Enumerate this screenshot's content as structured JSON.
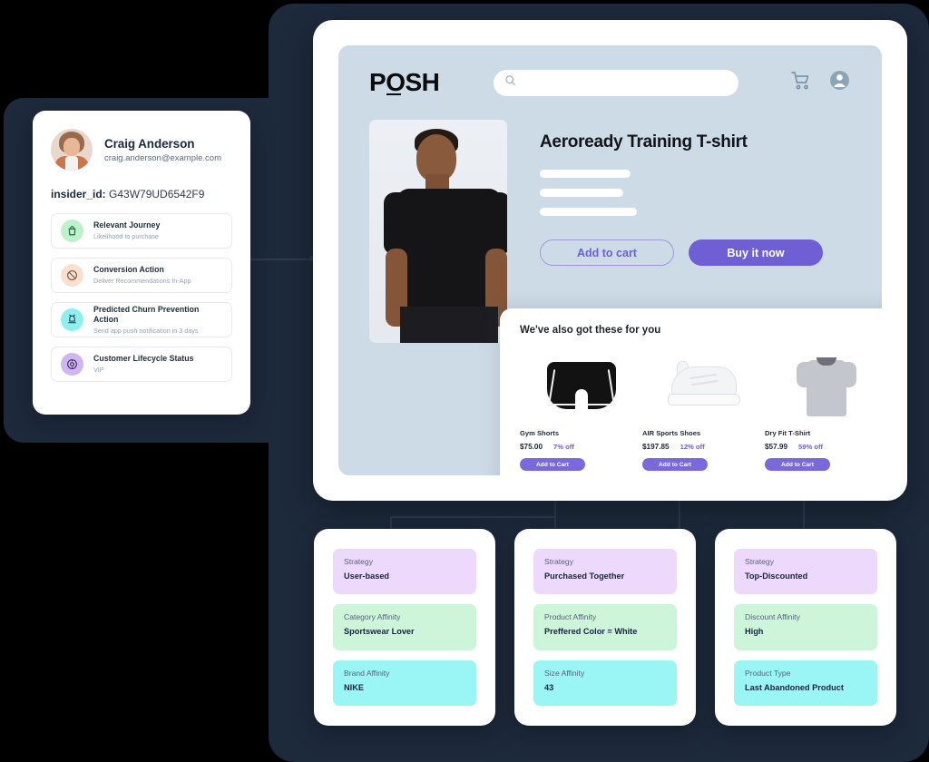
{
  "colors": {
    "background": "#000000",
    "panel_dark": "#1d2a3c",
    "accent_purple": "#6f5fd4",
    "shop_header": "#ccdbe6",
    "chip_purple": "#ecd9fb",
    "chip_green": "#cdf5d9",
    "chip_cyan": "#9af5f5"
  },
  "profile": {
    "name": "Craig Anderson",
    "email": "craig.anderson@example.com",
    "insider_label": "insider_id:",
    "insider_value": "G43W79UD6542F9",
    "avatar_icon": "user-avatar-photo",
    "attributes": [
      {
        "title": "Relevant Journey",
        "subtitle": "Likelihood to purchase",
        "icon": "shopping-bag-icon",
        "icon_color": "#bdf0cb"
      },
      {
        "title": "Conversion Action",
        "subtitle": "Deliver Recommendations In-App",
        "icon": "no-entry-icon",
        "icon_color": "#fbdfcf"
      },
      {
        "title": "Predicted Churn Prevention Action",
        "subtitle": "Send app push notification in 3 days",
        "icon": "notification-bell-icon",
        "icon_color": "#8fefef"
      },
      {
        "title": "Customer Lifecycle Status",
        "subtitle": "VIP",
        "icon": "target-icon",
        "icon_color": "#cfb6f0"
      }
    ]
  },
  "shop": {
    "logo": {
      "prefix": "P",
      "o": "O",
      "suffix": "SH",
      "full": "POSH"
    },
    "search": {
      "placeholder": "",
      "value": "",
      "icon": "search-icon"
    },
    "header_icons": [
      {
        "name": "cart-icon"
      },
      {
        "name": "account-icon"
      }
    ],
    "product": {
      "title": "Aeroready Training T-shirt",
      "image_alt": "man-wearing-black-tshirt",
      "description_placeholder_lines": 3,
      "buttons": {
        "add_to_cart": "Add to cart",
        "buy_now": "Buy it now"
      }
    },
    "recommendations": {
      "title": "We've also got these for you",
      "add_to_cart_label": "Add to Cart",
      "items": [
        {
          "name": "Gym Shorts",
          "price": "$75.00",
          "discount": "7% off",
          "image_alt": "black-gym-shorts"
        },
        {
          "name": "AIR Sports Shoes",
          "price": "$197.85",
          "discount": "12% off",
          "image_alt": "white-sports-shoe"
        },
        {
          "name": "Dry Fit T-Shirt",
          "price": "$57.99",
          "discount": "59% off",
          "image_alt": "grey-tshirt"
        }
      ]
    }
  },
  "strategy_cards": [
    {
      "rows": [
        {
          "label": "Strategy",
          "value": "User-based",
          "tone": "purple"
        },
        {
          "label": "Category Affinity",
          "value": "Sportswear Lover",
          "tone": "green"
        },
        {
          "label": "Brand Affinity",
          "value": "NIKE",
          "tone": "cyan"
        }
      ]
    },
    {
      "rows": [
        {
          "label": "Strategy",
          "value": "Purchased Together",
          "tone": "purple"
        },
        {
          "label": "Product Affinity",
          "value": "Preffered Color = White",
          "tone": "green"
        },
        {
          "label": "Size Affinity",
          "value": "43",
          "tone": "cyan"
        }
      ]
    },
    {
      "rows": [
        {
          "label": "Strategy",
          "value": "Top-Discounted",
          "tone": "purple"
        },
        {
          "label": "Discount Affinity",
          "value": "High",
          "tone": "green"
        },
        {
          "label": "Product Type",
          "value": "Last Abandoned Product",
          "tone": "cyan"
        }
      ]
    }
  ]
}
